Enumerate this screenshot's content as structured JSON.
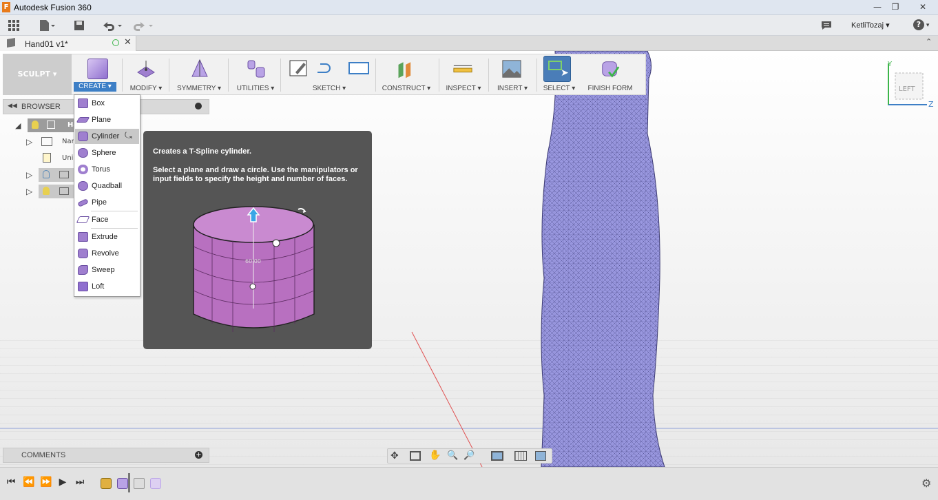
{
  "window": {
    "title": "Autodesk Fusion 360",
    "app_icon": "F",
    "controls": [
      "minimize-icon",
      "restore-icon",
      "close-icon"
    ]
  },
  "quick_access": {
    "user": "KetliTozaj",
    "help": "?",
    "icons": [
      "apps-grid-icon",
      "file-icon",
      "save-icon",
      "undo-icon",
      "redo-icon",
      "comment-icon"
    ]
  },
  "document": {
    "tab_title": "Hand01 v1*"
  },
  "ribbon": {
    "workspace": "SCULPT",
    "groups": [
      {
        "label": "CREATE",
        "icon": "box-icon"
      },
      {
        "label": "MODIFY",
        "icon": "modify-icon"
      },
      {
        "label": "SYMMETRY",
        "icon": "symmetry-icon"
      },
      {
        "label": "UTILITIES",
        "icon": "utilities-icon"
      },
      {
        "label": "SKETCH",
        "icon": "sketch-icon"
      },
      {
        "label": "CONSTRUCT",
        "icon": "construct-icon"
      },
      {
        "label": "INSPECT",
        "icon": "measure-icon"
      },
      {
        "label": "INSERT",
        "icon": "image-icon"
      },
      {
        "label": "SELECT",
        "icon": "select-icon"
      },
      {
        "label": "FINISH FORM",
        "icon": "finish-form-icon"
      }
    ]
  },
  "browser": {
    "title": "BROWSER",
    "rows": [
      {
        "label": "Ha"
      },
      {
        "label": "Nar"
      },
      {
        "label": "Uni"
      }
    ]
  },
  "create_menu": {
    "items": [
      {
        "label": "Box"
      },
      {
        "label": "Plane"
      },
      {
        "label": "Cylinder"
      },
      {
        "label": "Sphere"
      },
      {
        "label": "Torus"
      },
      {
        "label": "Quadball"
      },
      {
        "label": "Pipe"
      },
      {
        "label": "Face"
      },
      {
        "label": "Extrude"
      },
      {
        "label": "Revolve"
      },
      {
        "label": "Sweep"
      },
      {
        "label": "Loft"
      }
    ],
    "selected": "Cylinder"
  },
  "tooltip": {
    "heading": "Creates a T-Spline cylinder.",
    "description": "Select a plane and draw a circle. Use the manipulators or input fields to specify the height and number of faces.",
    "dimension": "60.00"
  },
  "viewcube": {
    "face": "LEFT",
    "axis_y": "Y",
    "axis_z": "Z"
  },
  "comments": {
    "title": "COMMENTS"
  },
  "colors": {
    "mesh": "#9a98e0",
    "cylinder": "#b870c0",
    "tooltip_bg": "#555555",
    "select_active": "#4a7db8"
  }
}
